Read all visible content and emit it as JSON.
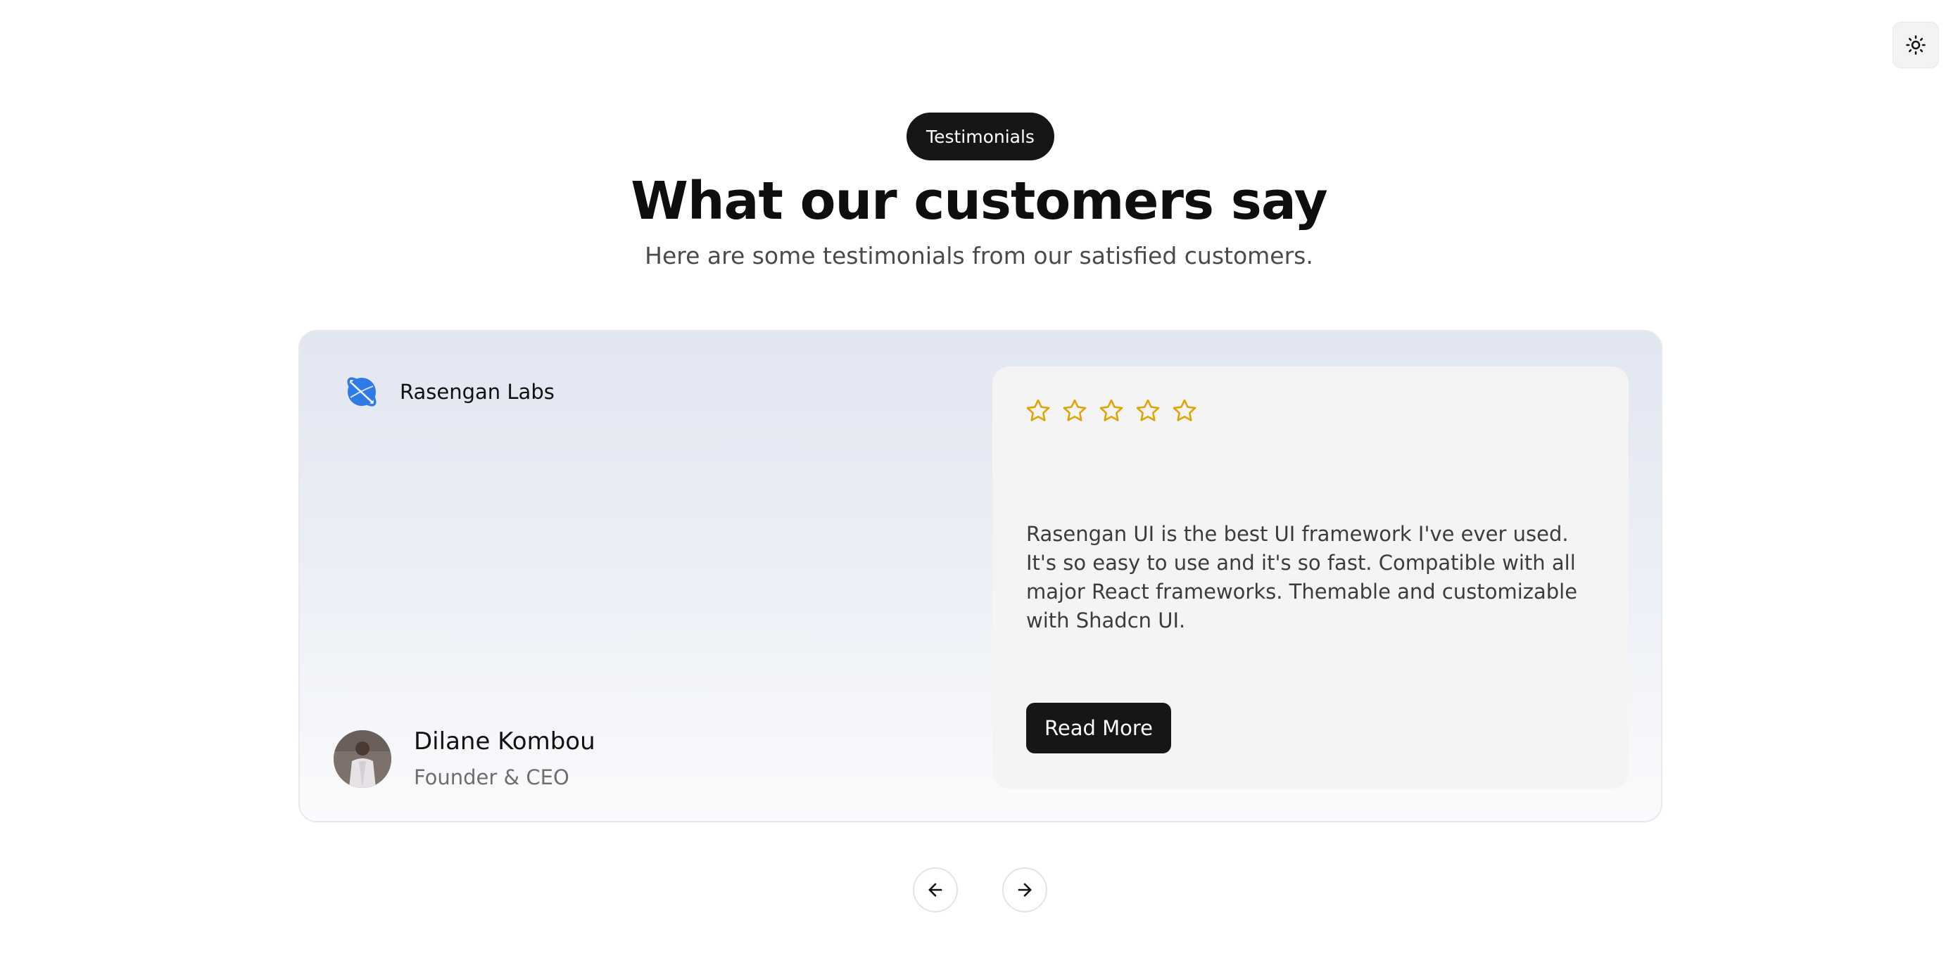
{
  "header": {
    "badge": "Testimonials",
    "title": "What our customers say",
    "subtitle": "Here are some testimonials from our satisfied customers."
  },
  "theme_toggle": {
    "icon": "sun-icon"
  },
  "testimonial": {
    "company": {
      "name": "Rasengan Labs",
      "logo_color": "#2f7be6"
    },
    "person": {
      "name": "Dilane Kombou",
      "role": "Founder & CEO"
    },
    "rating": {
      "stars": 5,
      "star_color": "#e0a400"
    },
    "quote": "Rasengan UI is the best UI framework I've ever used. It's so easy to use and it's so fast. Compatible with all major React frameworks. Themable and customizable with Shadcn UI.",
    "cta_label": "Read More"
  },
  "navigation": {
    "prev_icon": "arrow-left-icon",
    "next_icon": "arrow-right-icon"
  }
}
